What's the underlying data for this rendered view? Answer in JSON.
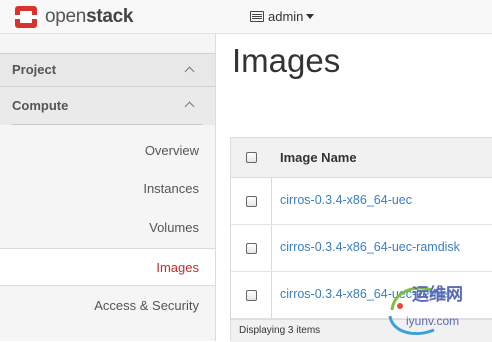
{
  "brand": {
    "name_light": "open",
    "name_bold": "stack"
  },
  "user_menu": {
    "label": "admin"
  },
  "sidebar": {
    "project_label": "Project",
    "compute_label": "Compute",
    "items": [
      {
        "label": "Overview"
      },
      {
        "label": "Instances"
      },
      {
        "label": "Volumes"
      },
      {
        "label": "Images",
        "active": true
      },
      {
        "label": "Access & Security"
      }
    ]
  },
  "main": {
    "title": "Images",
    "table": {
      "column_header": "Image Name",
      "rows": [
        {
          "name": "cirros-0.3.4-x86_64-uec"
        },
        {
          "name": "cirros-0.3.4-x86_64-uec-ramdisk"
        },
        {
          "name": "cirros-0.3.4-x86_64-uec-kernel"
        }
      ],
      "footer": "Displaying 3 items"
    }
  },
  "watermark": {
    "line1": "运维网",
    "line2": "iyunv.com"
  },
  "colors": {
    "active": "#cc2b2b",
    "link": "#3a7ec4",
    "brand_red": "#d9332e"
  }
}
